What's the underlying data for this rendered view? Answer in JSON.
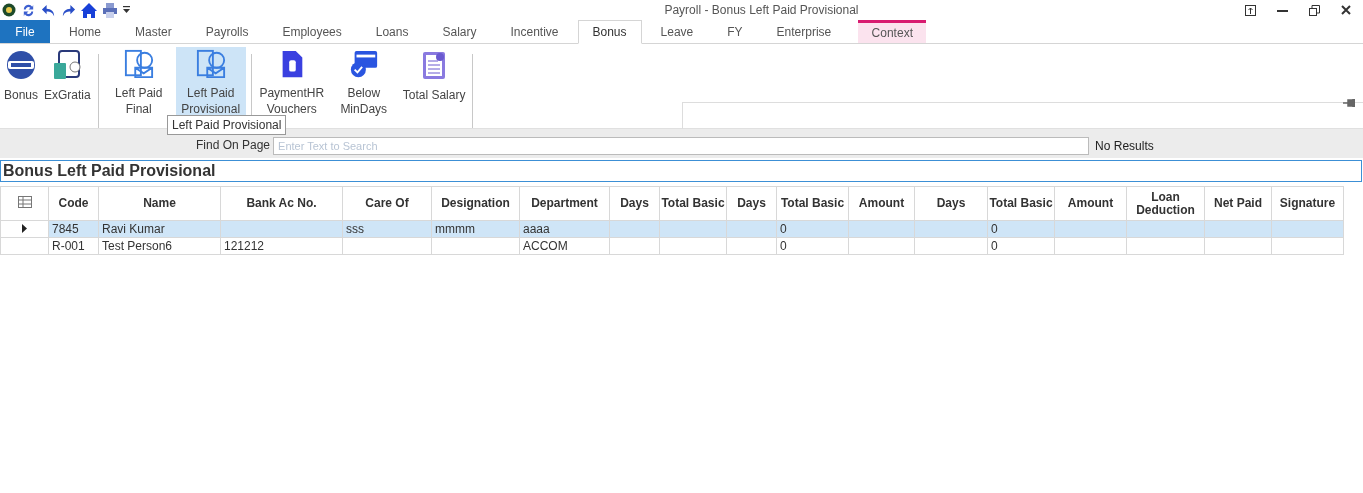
{
  "window": {
    "title": "Payroll - Bonus Left Paid Provisional"
  },
  "tabs": [
    {
      "label": "File",
      "kind": "file",
      "selected": false
    },
    {
      "label": "Home",
      "kind": "tab",
      "selected": false
    },
    {
      "label": "Master",
      "kind": "tab",
      "selected": false
    },
    {
      "label": "Payrolls",
      "kind": "tab",
      "selected": false
    },
    {
      "label": "Employees",
      "kind": "tab",
      "selected": false
    },
    {
      "label": "Loans",
      "kind": "tab",
      "selected": false
    },
    {
      "label": "Salary",
      "kind": "tab",
      "selected": false
    },
    {
      "label": "Incentive",
      "kind": "tab",
      "selected": false
    },
    {
      "label": "Bonus",
      "kind": "tab",
      "selected": true
    },
    {
      "label": "Leave",
      "kind": "tab",
      "selected": false
    },
    {
      "label": "FY",
      "kind": "tab",
      "selected": false
    },
    {
      "label": "Enterprise",
      "kind": "tab",
      "selected": false
    },
    {
      "label": "Context",
      "kind": "context",
      "selected": false
    }
  ],
  "ribbon": [
    [
      {
        "label": "Bonus",
        "selected": false
      },
      {
        "label": "ExGratia",
        "selected": false
      }
    ],
    [
      {
        "label": "Left Paid Final",
        "selected": false
      },
      {
        "label": "Left Paid Provisional",
        "selected": true
      }
    ],
    [
      {
        "label": "PaymentHR Vouchers",
        "selected": false
      },
      {
        "label": "Below MinDays",
        "selected": false
      },
      {
        "label": "Total Salary",
        "selected": false
      }
    ]
  ],
  "tooltip": "Left Paid Provisional",
  "find": {
    "label": "Find On Page",
    "placeholder": "Enter Text to Search",
    "results": "No Results"
  },
  "page_title": "Bonus Left Paid Provisional",
  "table": {
    "columns": [
      "Code",
      "Name",
      "Bank Ac No.",
      "Care Of",
      "Designation",
      "Department",
      "Days",
      "Total Basic",
      "Days",
      "Total Basic",
      "Amount",
      "Days",
      "Total Basic",
      "Amount",
      "Loan Deduction",
      "Net Paid",
      "Signature"
    ],
    "rows": [
      {
        "selected": true,
        "cells": [
          "7845",
          "Ravi Kumar",
          "",
          "sss",
          "mmmm",
          "aaaa",
          "",
          "",
          "",
          "0",
          "",
          "",
          "0",
          "",
          "",
          "",
          ""
        ]
      },
      {
        "selected": false,
        "cells": [
          "R-001",
          "Test Person6",
          "121212",
          "",
          "",
          "ACCOM",
          "",
          "",
          "",
          "0",
          "",
          "",
          "0",
          "",
          "",
          "",
          ""
        ]
      }
    ]
  }
}
